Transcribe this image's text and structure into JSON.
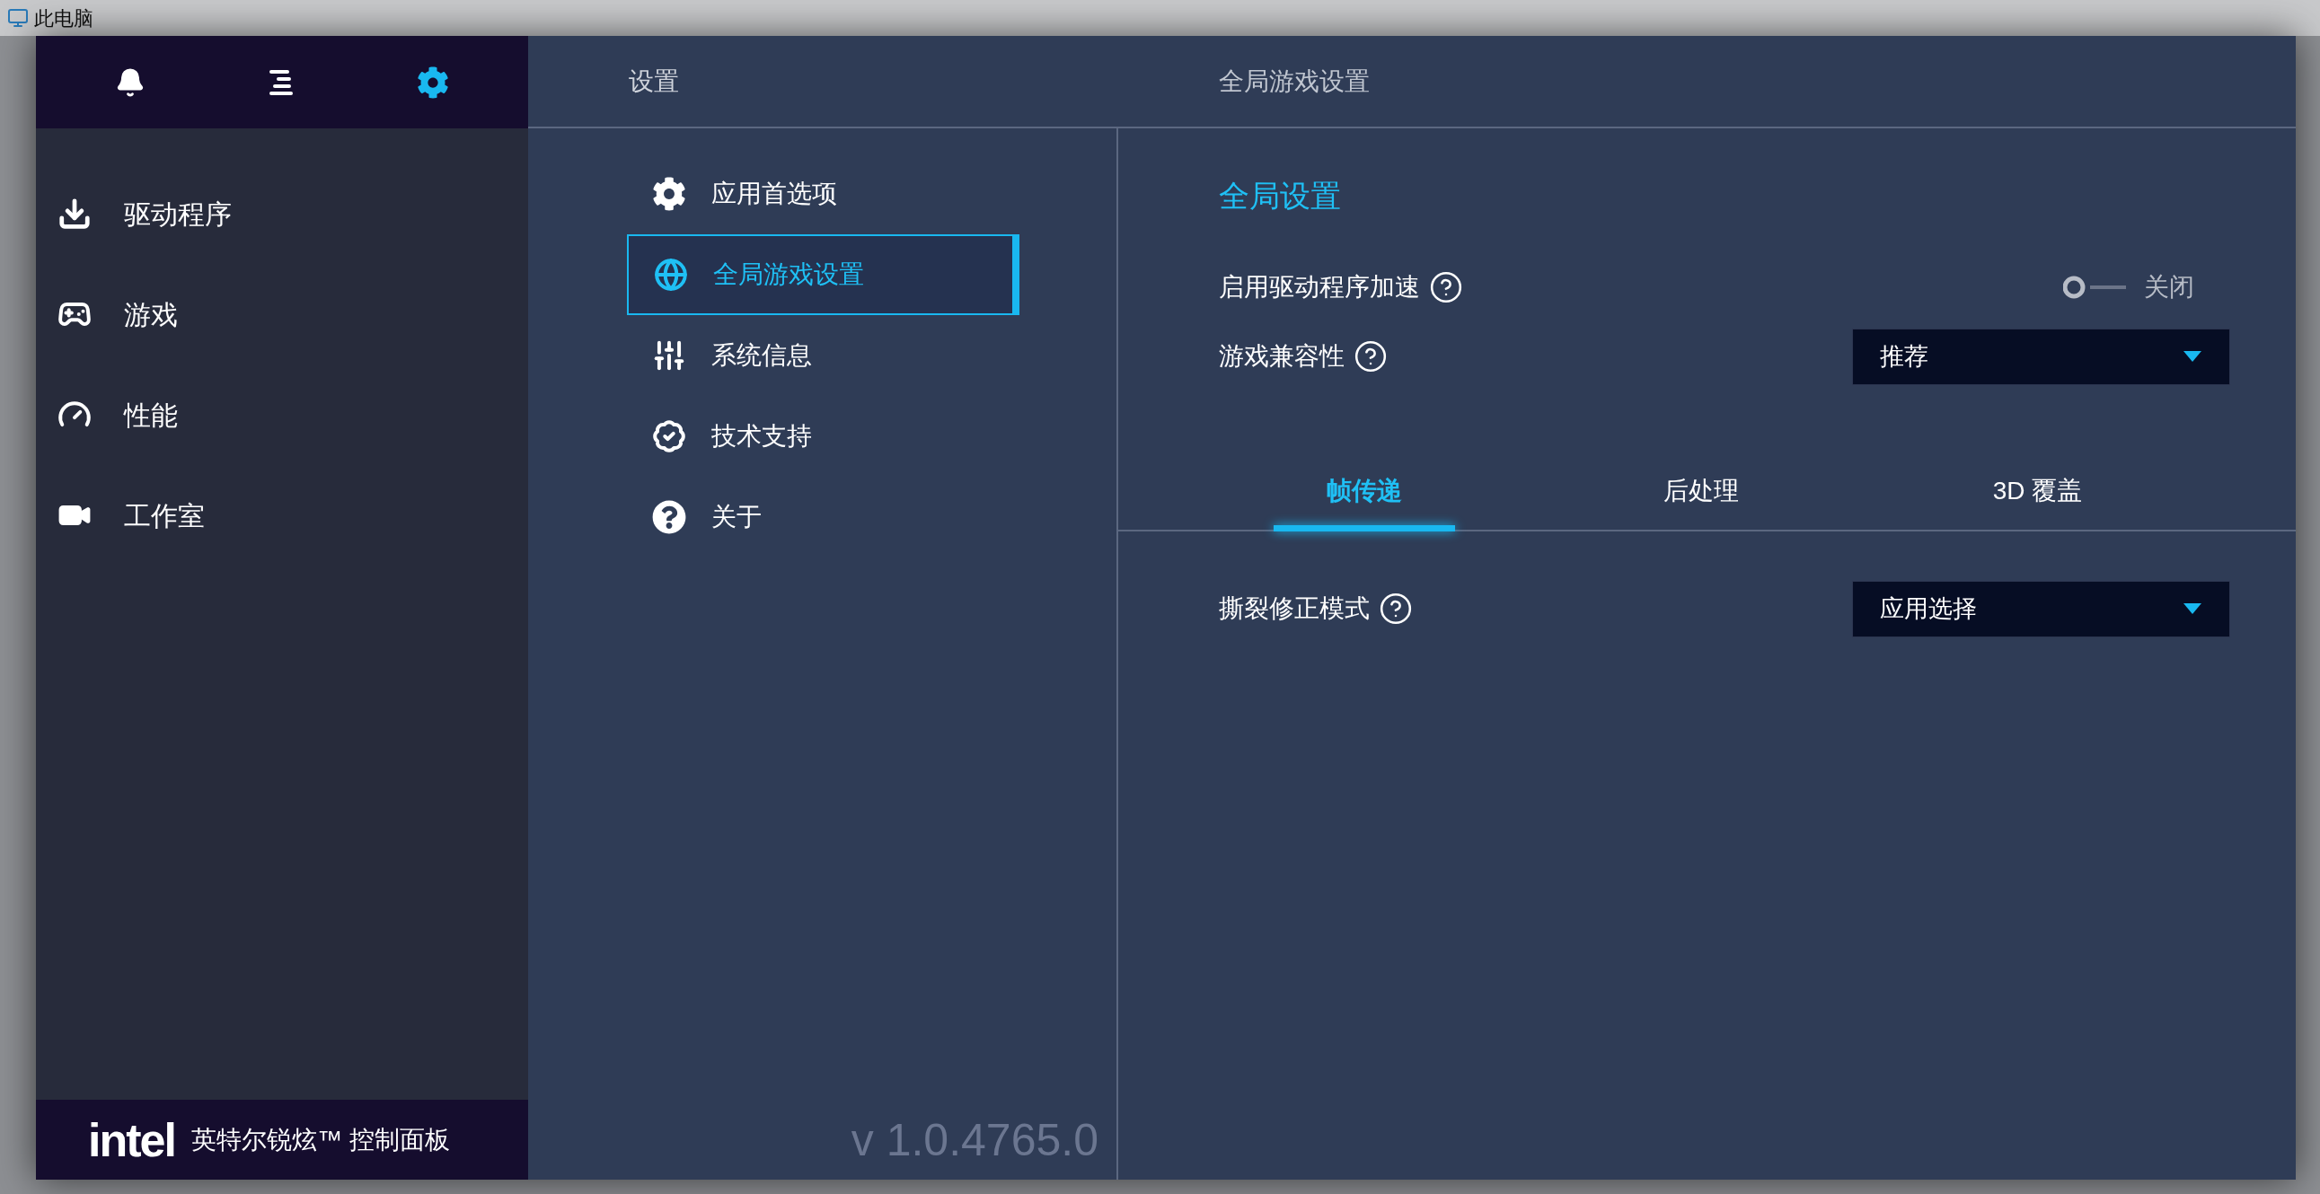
{
  "explorer": {
    "title": "此电脑"
  },
  "app": {
    "top_tabs": [
      {
        "kind": "notifications",
        "selected": false
      },
      {
        "kind": "menu",
        "selected": false
      },
      {
        "kind": "settings",
        "selected": true
      }
    ],
    "nav": [
      {
        "label": "驱动程序",
        "kind": "drivers"
      },
      {
        "label": "游戏",
        "kind": "games"
      },
      {
        "label": "性能",
        "kind": "performance"
      },
      {
        "label": "工作室",
        "kind": "studio"
      }
    ],
    "footer": {
      "logo": "intel",
      "product": "英特尔锐炫™ 控制面板"
    },
    "header": {
      "section": "设置",
      "title": "全局游戏设置"
    },
    "menu": [
      {
        "label": "应用首选项",
        "kind": "preferences",
        "selected": false
      },
      {
        "label": "全局游戏设置",
        "kind": "global",
        "selected": true
      },
      {
        "label": "系统信息",
        "kind": "system",
        "selected": false
      },
      {
        "label": "技术支持",
        "kind": "support",
        "selected": false
      },
      {
        "label": "关于",
        "kind": "about",
        "selected": false
      }
    ],
    "version": "v 1.0.4765.0",
    "heading": "全局设置",
    "settings": [
      {
        "kind": "toggle",
        "label": "启用驱动程序加速",
        "on": false,
        "value": "关闭"
      },
      {
        "kind": "dropdown",
        "label": "游戏兼容性",
        "value": "推荐"
      }
    ],
    "tabs": [
      {
        "label": "帧传递",
        "selected": true
      },
      {
        "label": "后处理",
        "selected": false
      },
      {
        "label": "3D 覆盖",
        "selected": false
      }
    ],
    "tab_settings": [
      {
        "kind": "dropdown",
        "label": "撕裂修正模式",
        "value": "应用选择"
      }
    ]
  }
}
